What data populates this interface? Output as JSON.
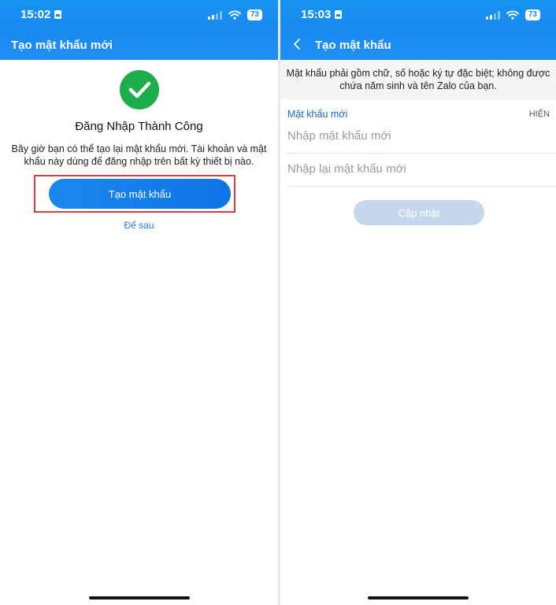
{
  "left": {
    "status": {
      "time": "15:02",
      "battery": "73"
    },
    "header": {
      "title": "Tạo mật khẩu mới"
    },
    "success": {
      "heading": "Đăng Nhập Thành Công",
      "description": "Bây giờ bạn có thể tạo lại mật khẩu mới. Tài khoản và mật khẩu này dùng để đăng nhập trên bất kỳ thiết bị nào."
    },
    "buttons": {
      "create_password": "Tạo mật khẩu",
      "later": "Để sau"
    }
  },
  "right": {
    "status": {
      "time": "15:03",
      "battery": "73"
    },
    "header": {
      "title": "Tạo mật khẩu"
    },
    "notice": "Mật khẩu phải gồm chữ, số hoặc ký tự đặc biệt; không được chứa năm sinh và tên Zalo của bạn.",
    "form": {
      "label": "Mật khẩu mới",
      "show_toggle": "HIỆN",
      "new_password_placeholder": "Nhập mật khẩu mới",
      "confirm_password_placeholder": "Nhập lại mật khẩu mới",
      "update_button": "Cập nhật"
    }
  },
  "icons": {
    "success": "check-circle-icon",
    "back": "chevron-left-icon",
    "wifi": "wifi-icon",
    "signal": "cellular-signal-icon",
    "battery": "battery-icon",
    "sim": "sim-card-icon"
  },
  "colors": {
    "header_blue": "#1a8af2",
    "success_green": "#1dae4c",
    "highlight_red": "#e03a3e",
    "disabled_button": "#c5d7ea",
    "link_blue": "#1f7cd6"
  }
}
